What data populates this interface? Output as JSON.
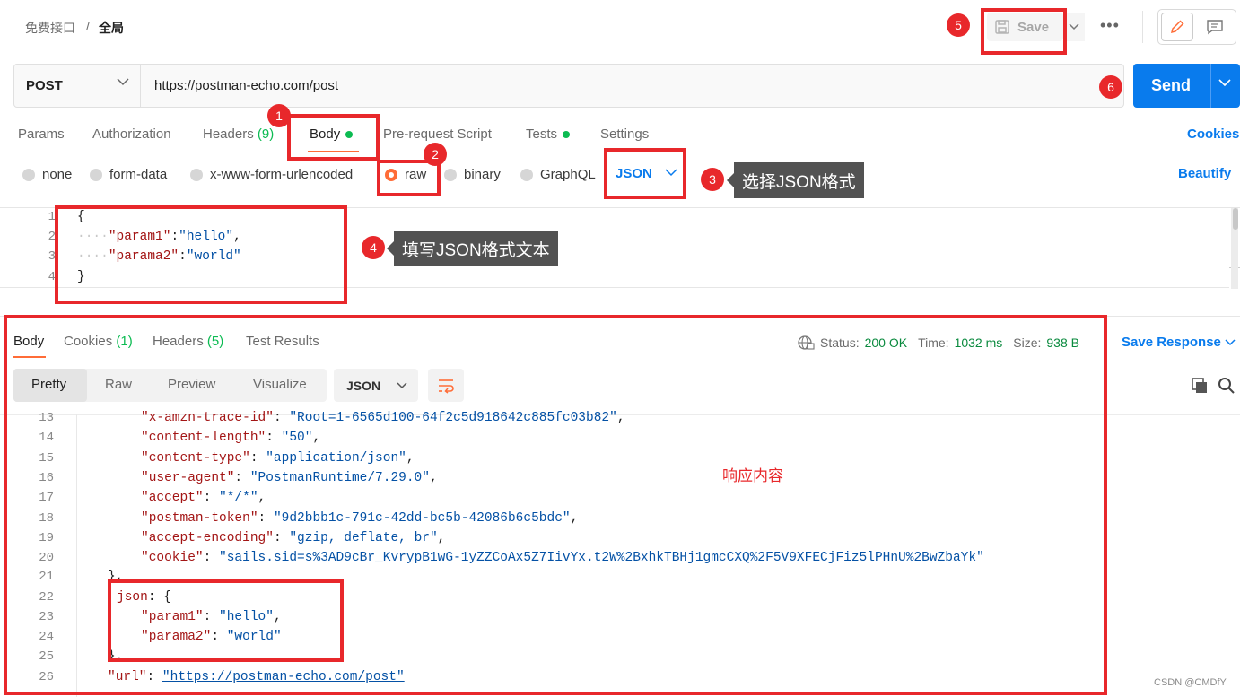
{
  "breadcrumb": {
    "parent": "免费接口",
    "separator": "/",
    "current": "全局"
  },
  "toolbar": {
    "save_label": "Save",
    "more": "•••"
  },
  "request": {
    "method": "POST",
    "url": "https://postman-echo.com/post",
    "send_label": "Send"
  },
  "request_tabs": {
    "params": "Params",
    "authorization": "Authorization",
    "headers": "Headers",
    "headers_count": "(9)",
    "body": "Body",
    "prerequest": "Pre-request Script",
    "tests": "Tests",
    "settings": "Settings",
    "cookies": "Cookies"
  },
  "body_types": {
    "none": "none",
    "form_data": "form-data",
    "urlencoded": "x-www-form-urlencoded",
    "raw": "raw",
    "binary": "binary",
    "graphql": "GraphQL",
    "format": "JSON",
    "beautify": "Beautify"
  },
  "editor": {
    "line_numbers": [
      "1",
      "2",
      "3",
      "4"
    ],
    "open_brace": "{",
    "close_brace": "}",
    "indent_dots": "····",
    "key1": "\"param1\"",
    "val1": "\"hello\"",
    "key2": "\"parama2\"",
    "val2": "\"world\"",
    "colon": ":",
    "comma": ","
  },
  "response_tabs": {
    "body": "Body",
    "cookies": "Cookies",
    "cookies_count": "(1)",
    "headers": "Headers",
    "headers_count": "(5)",
    "tests": "Test Results"
  },
  "response_meta": {
    "status_label": "Status:",
    "status_value": "200 OK",
    "time_label": "Time:",
    "time_value": "1032 ms",
    "size_label": "Size:",
    "size_value": "938 B",
    "save_response": "Save Response"
  },
  "response_view": {
    "pretty": "Pretty",
    "raw": "Raw",
    "preview": "Preview",
    "visualize": "Visualize",
    "format": "JSON"
  },
  "response_lines": [
    {
      "n": "13",
      "key": "\"x-amzn-trace-id\"",
      "val": "\"Root=1-6565d100-64f2c5d918642c885fc03b82\"",
      "end": ","
    },
    {
      "n": "14",
      "key": "\"content-length\"",
      "val": "\"50\"",
      "end": ","
    },
    {
      "n": "15",
      "key": "\"content-type\"",
      "val": "\"application/json\"",
      "end": ","
    },
    {
      "n": "16",
      "key": "\"user-agent\"",
      "val": "\"PostmanRuntime/7.29.0\"",
      "end": ","
    },
    {
      "n": "17",
      "key": "\"accept\"",
      "val": "\"*/*\"",
      "end": ","
    },
    {
      "n": "18",
      "key": "\"postman-token\"",
      "val": "\"9d2bbb1c-791c-42dd-bc5b-42086b6c5bdc\"",
      "end": ","
    },
    {
      "n": "19",
      "key": "\"accept-encoding\"",
      "val": "\"gzip, deflate, br\"",
      "end": ","
    },
    {
      "n": "20",
      "key": "\"cookie\"",
      "val": "\"sails.sid=s%3AD9cBr_KvrypB1wG-1yZZCoAx5Z7IivYx.t2W%2BxhkTBHj1gmcCXQ%2F5V9XFECjFiz5lPHnU%2BwZbaYk\"",
      "end": ""
    }
  ],
  "response_tail": {
    "n21": "21",
    "close21": "},",
    "n22": "22",
    "json_key": "json",
    "open22": "{",
    "n23": "23",
    "k23": "\"param1\"",
    "v23": "\"hello\"",
    "n24": "24",
    "k24": "\"parama2\"",
    "v24": "\"world\"",
    "n25": "25",
    "close25": "},",
    "n26": "26",
    "url_key": "\"url\"",
    "url_val": "\"https://postman-echo.com/post\""
  },
  "annotations": {
    "badge1": "1",
    "badge2": "2",
    "badge3": "3",
    "badge4": "4",
    "badge5": "5",
    "badge6": "6",
    "tip3": "选择JSON格式",
    "tip4": "填写JSON格式文本",
    "response_note": "响应内容",
    "watermark": "CSDN @CMDfY"
  },
  "colors": {
    "accent": "#ff6c37",
    "primary": "#097bed",
    "annotation": "#e8282b",
    "success": "#0cbb52"
  }
}
